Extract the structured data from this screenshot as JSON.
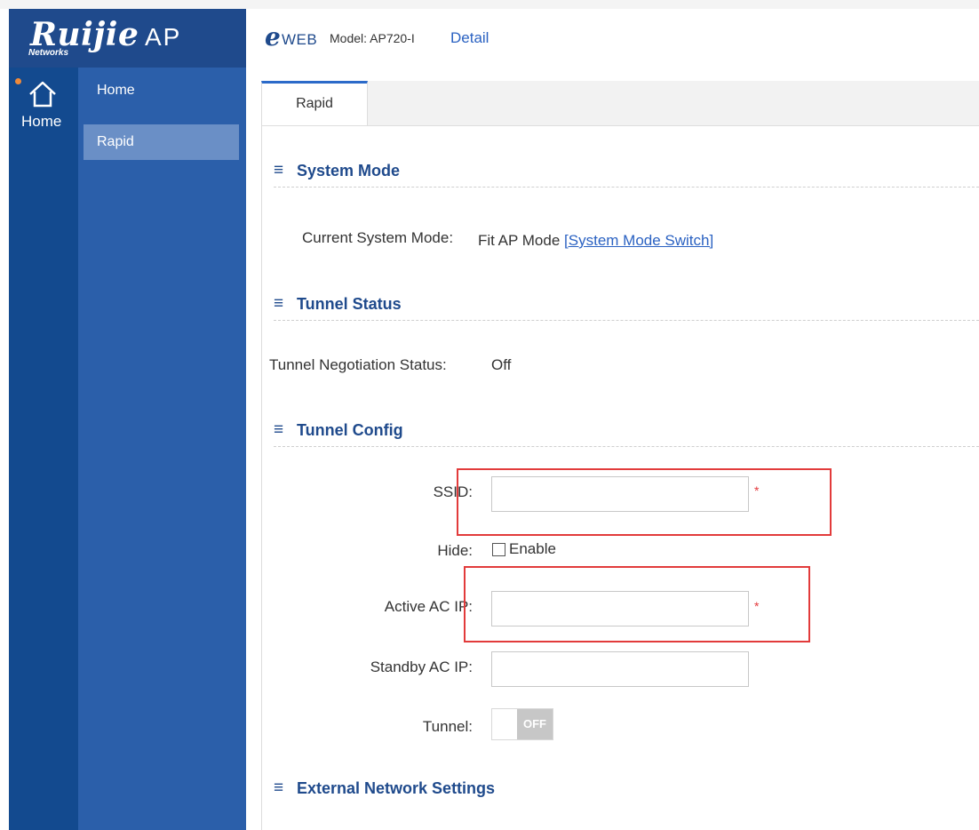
{
  "brand": {
    "logo_text": "Ruijie",
    "logo_sub": "Networks",
    "product": "AP"
  },
  "header": {
    "eweb_e": "e",
    "eweb_word": "WEB",
    "model": "Model: AP720-I",
    "detail_link": "Detail"
  },
  "rail": {
    "home_label": "Home",
    "home_icon": "home-icon",
    "notification_color": "#f08a3a"
  },
  "submenu": {
    "items": [
      {
        "label": "Home"
      },
      {
        "label": "Rapid",
        "active": true
      }
    ]
  },
  "tabs": [
    {
      "label": "Rapid",
      "active": true
    }
  ],
  "sections": {
    "system_mode": {
      "icon": "≡",
      "title": "System Mode",
      "label": "Current System Mode:",
      "value": "Fit AP Mode",
      "switch_link": "[System Mode Switch]"
    },
    "tunnel_status": {
      "icon": "≡",
      "title": "Tunnel Status",
      "label": "Tunnel Negotiation Status:",
      "value": "Off"
    },
    "tunnel_config": {
      "icon": "≡",
      "title": "Tunnel Config",
      "ssid_label": "SSID:",
      "ssid_value": "",
      "hide_label": "Hide:",
      "hide_checkbox_label": "Enable",
      "hide_checked": false,
      "active_ac_label": "Active AC IP:",
      "active_ac_value": "",
      "standby_ac_label": "Standby AC IP:",
      "standby_ac_value": "",
      "tunnel_label": "Tunnel:",
      "tunnel_toggle": "OFF",
      "required_mark": "*"
    },
    "external_network": {
      "icon": "≡",
      "title": "External Network Settings"
    }
  },
  "colors": {
    "brand_blue": "#1f4a8c",
    "rail_blue": "#134a8f",
    "submenu_blue": "#2b5faa",
    "active_submenu": "#6a8fc6",
    "link_blue": "#2b62c2",
    "annotation_red": "#e23b3b"
  }
}
